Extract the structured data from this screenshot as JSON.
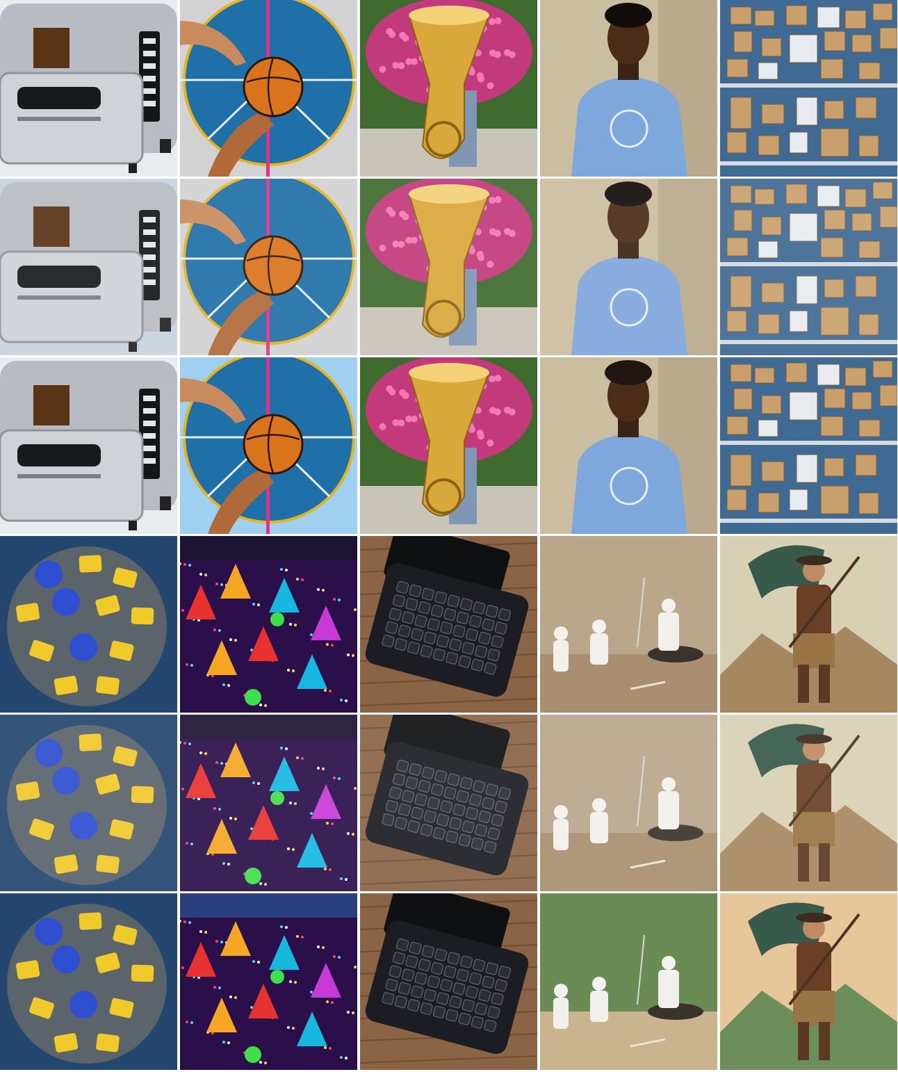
{
  "grid": {
    "rows": 6,
    "columns": 5,
    "background": "#ffffff",
    "cells": [
      {
        "subject": "toaster-oven",
        "style": "original"
      },
      {
        "subject": "basketball-hands",
        "style": "original"
      },
      {
        "subject": "tuba-flowers",
        "style": "original"
      },
      {
        "subject": "man-blue-tshirt",
        "style": "original"
      },
      {
        "subject": "boxes-aerial",
        "style": "original"
      },
      {
        "subject": "toaster-oven",
        "style": "degraded"
      },
      {
        "subject": "basketball-hands",
        "style": "degraded"
      },
      {
        "subject": "tuba-flowers",
        "style": "degraded"
      },
      {
        "subject": "man-blue-tshirt",
        "style": "degraded"
      },
      {
        "subject": "boxes-aerial",
        "style": "degraded"
      },
      {
        "subject": "toaster-oven",
        "style": "restyled"
      },
      {
        "subject": "basketball-hands",
        "style": "restyled"
      },
      {
        "subject": "tuba-flowers",
        "style": "restyled"
      },
      {
        "subject": "man-blue-tshirt",
        "style": "restyled"
      },
      {
        "subject": "boxes-aerial",
        "style": "restyled"
      },
      {
        "subject": "patterned-ball",
        "style": "original"
      },
      {
        "subject": "carnival-night",
        "style": "original"
      },
      {
        "subject": "laptop-keyboard",
        "style": "original"
      },
      {
        "subject": "fencers-white",
        "style": "original"
      },
      {
        "subject": "wanderer-cloak",
        "style": "original"
      },
      {
        "subject": "patterned-ball",
        "style": "degraded"
      },
      {
        "subject": "carnival-night",
        "style": "degraded"
      },
      {
        "subject": "laptop-keyboard",
        "style": "degraded"
      },
      {
        "subject": "fencers-white",
        "style": "degraded"
      },
      {
        "subject": "wanderer-cloak",
        "style": "degraded"
      },
      {
        "subject": "patterned-ball",
        "style": "restyled"
      },
      {
        "subject": "carnival-night",
        "style": "restyled"
      },
      {
        "subject": "laptop-keyboard",
        "style": "restyled"
      },
      {
        "subject": "fencers-white",
        "style": "restyled"
      },
      {
        "subject": "wanderer-cloak",
        "style": "restyled"
      }
    ]
  },
  "colors": {
    "steel": "#b8bcc2",
    "court_blue": "#1f6fa8",
    "court_yellow": "#e7b21a",
    "ball_orange": "#d9731c",
    "flower_pink": "#c23a7b",
    "brass": "#d8a83a",
    "foliage": "#3f6b2e",
    "shirt_blue": "#7ea7dc",
    "wall_beige": "#cbbda0",
    "cardboard": "#c9a06c",
    "tarmac_blue": "#3e6a94",
    "ball_gray": "#5b636b",
    "ball_yellow": "#f0c92b",
    "ball_blue": "#2d4fd0",
    "night_purple": "#2a0f4a",
    "wood": "#8a6445",
    "laptop_black": "#1c1d22",
    "stone": "#b9a68b",
    "sky": "#d8d0b5"
  }
}
